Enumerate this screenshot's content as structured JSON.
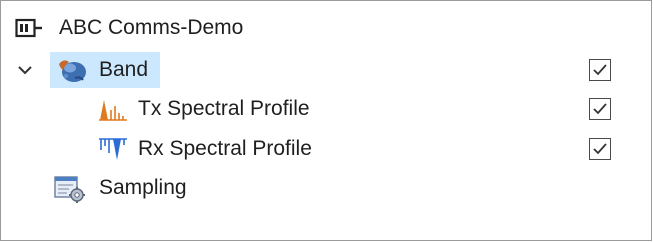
{
  "tree": {
    "root": {
      "label": "ABC Comms-Demo",
      "icon": "device-icon"
    },
    "band": {
      "label": "Band",
      "icon": "band-globe-icon",
      "expanded": true,
      "checked": true,
      "selected": true,
      "children": [
        {
          "label": "Tx Spectral Profile",
          "icon": "tx-spectrum-icon",
          "checked": true
        },
        {
          "label": "Rx Spectral Profile",
          "icon": "rx-spectrum-icon",
          "checked": true
        }
      ]
    },
    "sampling": {
      "label": "Sampling",
      "icon": "sampling-gear-icon"
    }
  },
  "colors": {
    "selection": "#cce8ff",
    "tx_icon": "#e07a1f",
    "rx_icon": "#2c6bd6"
  }
}
